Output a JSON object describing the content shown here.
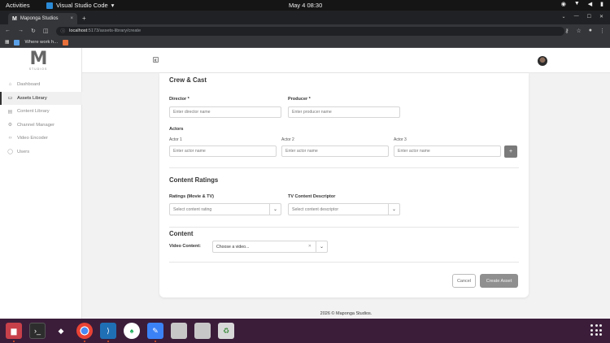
{
  "os": {
    "activities": "Activities",
    "app_name": "Visual Studio Code",
    "clock": "May 4  08:30"
  },
  "browser": {
    "tab_title": "Maponga Studios",
    "url_host": "localhost",
    "url_path": ":5173/assets-library/create",
    "bookmark": "Where work h..."
  },
  "sidebar": {
    "logo_letter": "M",
    "logo_sub": "STUDIOS",
    "items": [
      {
        "label": "Dashboard",
        "icon": "home-icon"
      },
      {
        "label": "Assets Library",
        "icon": "folder-icon"
      },
      {
        "label": "Content Library",
        "icon": "film-icon"
      },
      {
        "label": "Channel Manager",
        "icon": "settings-icon"
      },
      {
        "label": "Video Encoder",
        "icon": "code-icon"
      },
      {
        "label": "Users",
        "icon": "user-icon"
      }
    ],
    "active_index": 1
  },
  "form": {
    "crew": {
      "title": "Crew & Cast",
      "director_label": "Director *",
      "director_placeholder": "Enter director name",
      "producer_label": "Producer *",
      "producer_placeholder": "Enter producer name",
      "actors_label": "Actors",
      "actors": [
        {
          "label": "Actor 1",
          "placeholder": "Enter actor name"
        },
        {
          "label": "Actor 2",
          "placeholder": "Enter actor name"
        },
        {
          "label": "Actor 3",
          "placeholder": "Enter actor name"
        }
      ],
      "add_label": "+"
    },
    "ratings": {
      "title": "Content Ratings",
      "ratings_label": "Ratings (Movie & TV)",
      "ratings_placeholder": "Select content rating",
      "descriptor_label": "TV Content Descriptor",
      "descriptor_placeholder": "Select content descriptor"
    },
    "content": {
      "title": "Content",
      "video_label": "Video Content:",
      "video_placeholder": "Choose a video..."
    },
    "cancel_label": "Cancel",
    "create_label": "Create Asset"
  },
  "footer": "2026 © Maponga Studios."
}
